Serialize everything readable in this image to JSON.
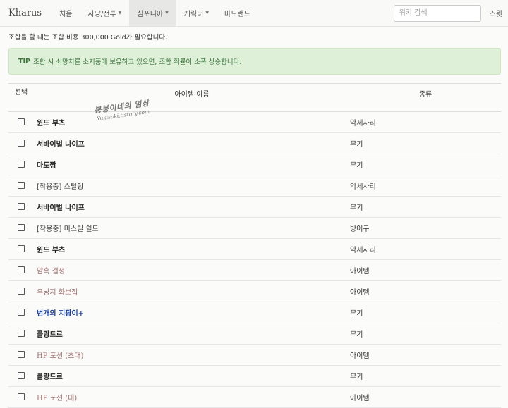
{
  "navbar": {
    "brand": "Kharus",
    "items": [
      {
        "label": "처음",
        "active": false,
        "dropdown": false
      },
      {
        "label": "사냥/전투",
        "active": false,
        "dropdown": true
      },
      {
        "label": "심포니아",
        "active": true,
        "dropdown": true
      },
      {
        "label": "캐릭터",
        "active": false,
        "dropdown": true
      },
      {
        "label": "마도랜드",
        "active": false,
        "dropdown": false
      }
    ],
    "search_placeholder": "위키 검색",
    "search_button": "스윗"
  },
  "notice": "조합을 할 때는 조합 비용 300,000 Gold가 필요합니다.",
  "alert": {
    "tip_label": "TIP",
    "text": "조합 시 쇠망치를 소지품에 보유하고 있으면, 조합 확률이 소폭 상승합니다."
  },
  "watermark": {
    "line1": "붕붕이네의 일상",
    "line2": "Yukisaki.tistory.com"
  },
  "table": {
    "headers": {
      "select": "선택",
      "name": "아이템 이름",
      "type": "종류"
    },
    "rows": [
      {
        "name": "윈드 부츠",
        "type": "악세사리",
        "style": "bold"
      },
      {
        "name": "서바이벌 나이프",
        "type": "무기",
        "style": "bold"
      },
      {
        "name": "마도짱",
        "type": "무기",
        "style": "bold"
      },
      {
        "name": "[착용중] 스털링",
        "type": "악세사리",
        "style": "normal"
      },
      {
        "name": "서바이벌 나이프",
        "type": "무기",
        "style": "bold"
      },
      {
        "name": "[착용중] 미스릴 쉴드",
        "type": "방어구",
        "style": "normal"
      },
      {
        "name": "윈드 부츠",
        "type": "악세사리",
        "style": "bold"
      },
      {
        "name": "암흑 결정",
        "type": "아이템",
        "style": "mat"
      },
      {
        "name": "우냥지 화보집",
        "type": "아이템",
        "style": "mat"
      },
      {
        "name": "번개의 지팡이+",
        "type": "무기",
        "style": "blue"
      },
      {
        "name": "플랑드르",
        "type": "무기",
        "style": "bold"
      },
      {
        "name": "HP 포션 (초대)",
        "type": "아이템",
        "style": "potion"
      },
      {
        "name": "플랑드르",
        "type": "무기",
        "style": "bold"
      },
      {
        "name": "HP 포션 (대)",
        "type": "아이템",
        "style": "potion"
      }
    ]
  }
}
